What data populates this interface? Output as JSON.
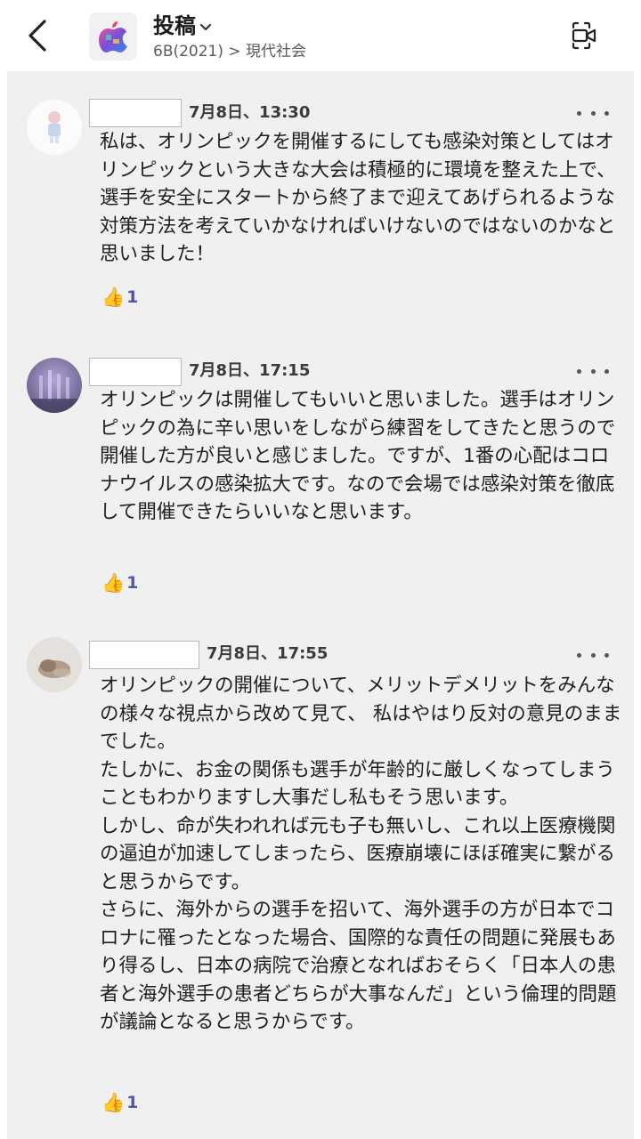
{
  "header": {
    "title": "投稿",
    "breadcrumb": "6B(2021) > 現代社会"
  },
  "posts": [
    {
      "timestamp": "7月8日、13:30",
      "body": "私は、オリンピックを開催するにしても感染対策としてはオリンピックという大きな大会は積極的に環境を整えた上で、選手を安全にスタートから終了まで迎えてあげられるような対策方法を考えていかなければいけないのではないのかなと思いました！",
      "reaction_icon": "👍",
      "reaction_count": "1"
    },
    {
      "timestamp": "7月8日、17:15",
      "body": "オリンピックは開催してもいいと思いました。選手はオリンピックの為に辛い思いをしながら練習をしてきたと思うので開催した方が良いと感じました。ですが、1番の心配はコロナウイルスの感染拡大です。なので会場では感染対策を徹底して開催できたらいいなと思います。",
      "reaction_icon": "👍",
      "reaction_count": "1"
    },
    {
      "timestamp": "7月8日、17:55",
      "body": "オリンピックの開催について、メリットデメリットをみんなの様々な視点から改めて見て、 私はやはり反対の意見のままでした。\nたしかに、お金の関係も選手が年齢的に厳しくなってしまうこともわかりますし大事だし私もそう思います。\nしかし、命が失われれば元も子も無いし、これ以上医療機関の逼迫が加速してしまったら、医療崩壊にほぼ確実に繋がると思うからです。\nさらに、海外からの選手を招いて、海外選手の方が日本でコロナに罹ったとなった場合、国際的な責任の問題に発展もあり得るし、日本の病院で治療となればおそらく「日本人の患者と海外選手の患者どちらが大事なんだ」という倫理的問題が議論となると思うからです。",
      "reaction_icon": "👍",
      "reaction_count": "1"
    }
  ]
}
